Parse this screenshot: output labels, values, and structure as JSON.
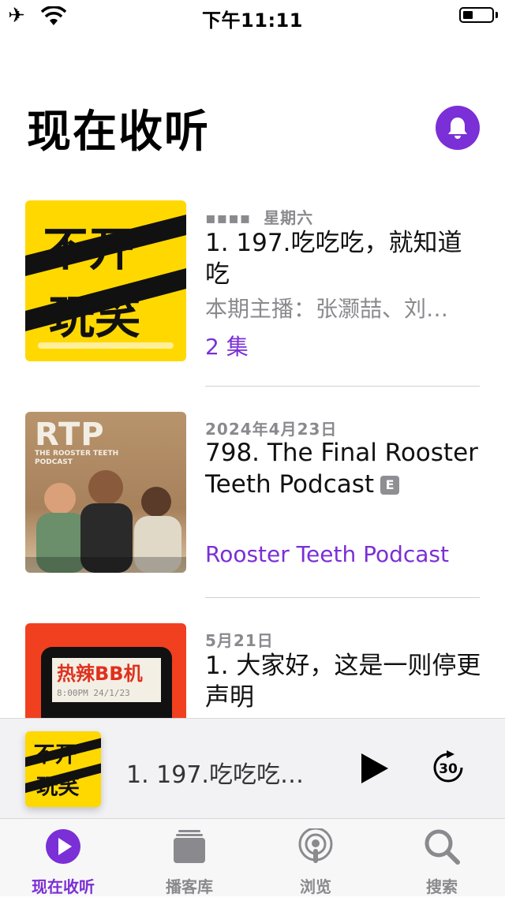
{
  "status_bar": {
    "time": "下午11:11",
    "airplane_icon": "✈"
  },
  "header": {
    "title": "现在收听"
  },
  "episodes": [
    {
      "meta": "星期六",
      "title": "1. 197.吃吃吃，就知道吃",
      "description": "本期主播：张灏喆、刘…",
      "link": "2 集",
      "artwork_text_lines": [
        "不开",
        "玩笑"
      ],
      "progress": 0.9
    },
    {
      "meta": "2024年4月23日",
      "title": "798. The Final Rooster Teeth Podcast",
      "explicit_badge": "E",
      "link": "Rooster Teeth Podcast",
      "artwork_logo": "RTP",
      "artwork_subtitle": "THE ROOSTER TEETH PODCAST"
    },
    {
      "meta": "5月21日",
      "title": "1. 大家好，这是一则停更声明",
      "artwork_text": "热辣BB机",
      "artwork_subtext": "8:00PM 24/1/23"
    }
  ],
  "mini_player": {
    "title": "1. 197.吃吃吃…",
    "skip_seconds": "30"
  },
  "tabs": [
    {
      "label": "现在收听",
      "icon": "play-circle-icon",
      "active": true
    },
    {
      "label": "播客库",
      "icon": "library-stack-icon",
      "active": false
    },
    {
      "label": "浏览",
      "icon": "podcast-broadcast-icon",
      "active": false
    },
    {
      "label": "搜索",
      "icon": "magnifier-icon",
      "active": false
    }
  ],
  "colors": {
    "accent": "#7b2fd6",
    "secondary_text": "#8a8a8e",
    "art_yellow": "#ffd800",
    "art_red": "#f1401f"
  }
}
